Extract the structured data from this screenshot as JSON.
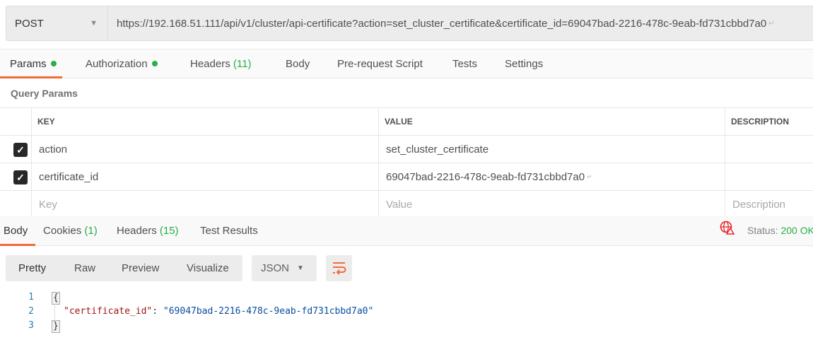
{
  "request": {
    "method": "POST",
    "url": "https://192.168.51.111/api/v1/cluster/api-certificate?action=set_cluster_certificate&certificate_id=69047bad-2216-478c-9eab-fd731cbbd7a0"
  },
  "tabs": [
    {
      "label": "Params",
      "dot": true
    },
    {
      "label": "Authorization",
      "dot": true
    },
    {
      "label": "Headers",
      "count": "(11)"
    },
    {
      "label": "Body"
    },
    {
      "label": "Pre-request Script"
    },
    {
      "label": "Tests"
    },
    {
      "label": "Settings"
    }
  ],
  "query_params": {
    "title": "Query Params",
    "headers": [
      "KEY",
      "VALUE",
      "DESCRIPTION"
    ],
    "rows": [
      {
        "checked": true,
        "key": "action",
        "value": "set_cluster_certificate"
      },
      {
        "checked": true,
        "key": "certificate_id",
        "value": "69047bad-2216-478c-9eab-fd731cbbd7a0"
      }
    ],
    "placeholders": {
      "key": "Key",
      "value": "Value",
      "description": "Description"
    }
  },
  "response": {
    "tabs": [
      {
        "label": "Body"
      },
      {
        "label": "Cookies",
        "count": "(1)"
      },
      {
        "label": "Headers",
        "count": "(15)"
      },
      {
        "label": "Test Results"
      }
    ],
    "status_label": "Status:",
    "status_value": "200 OK",
    "view_modes": [
      "Pretty",
      "Raw",
      "Preview",
      "Visualize"
    ],
    "format": "JSON",
    "code": {
      "line_numbers": [
        "1",
        "2",
        "3"
      ],
      "open": "{",
      "key": "\"certificate_id\"",
      "colon": ":",
      "value": "\"69047bad-2216-478c-9eab-fd731cbbd7a0\"",
      "close": "}"
    }
  },
  "colors": {
    "accent": "#f26b3a",
    "green": "#26b047",
    "error_icon": "#e8262b"
  }
}
